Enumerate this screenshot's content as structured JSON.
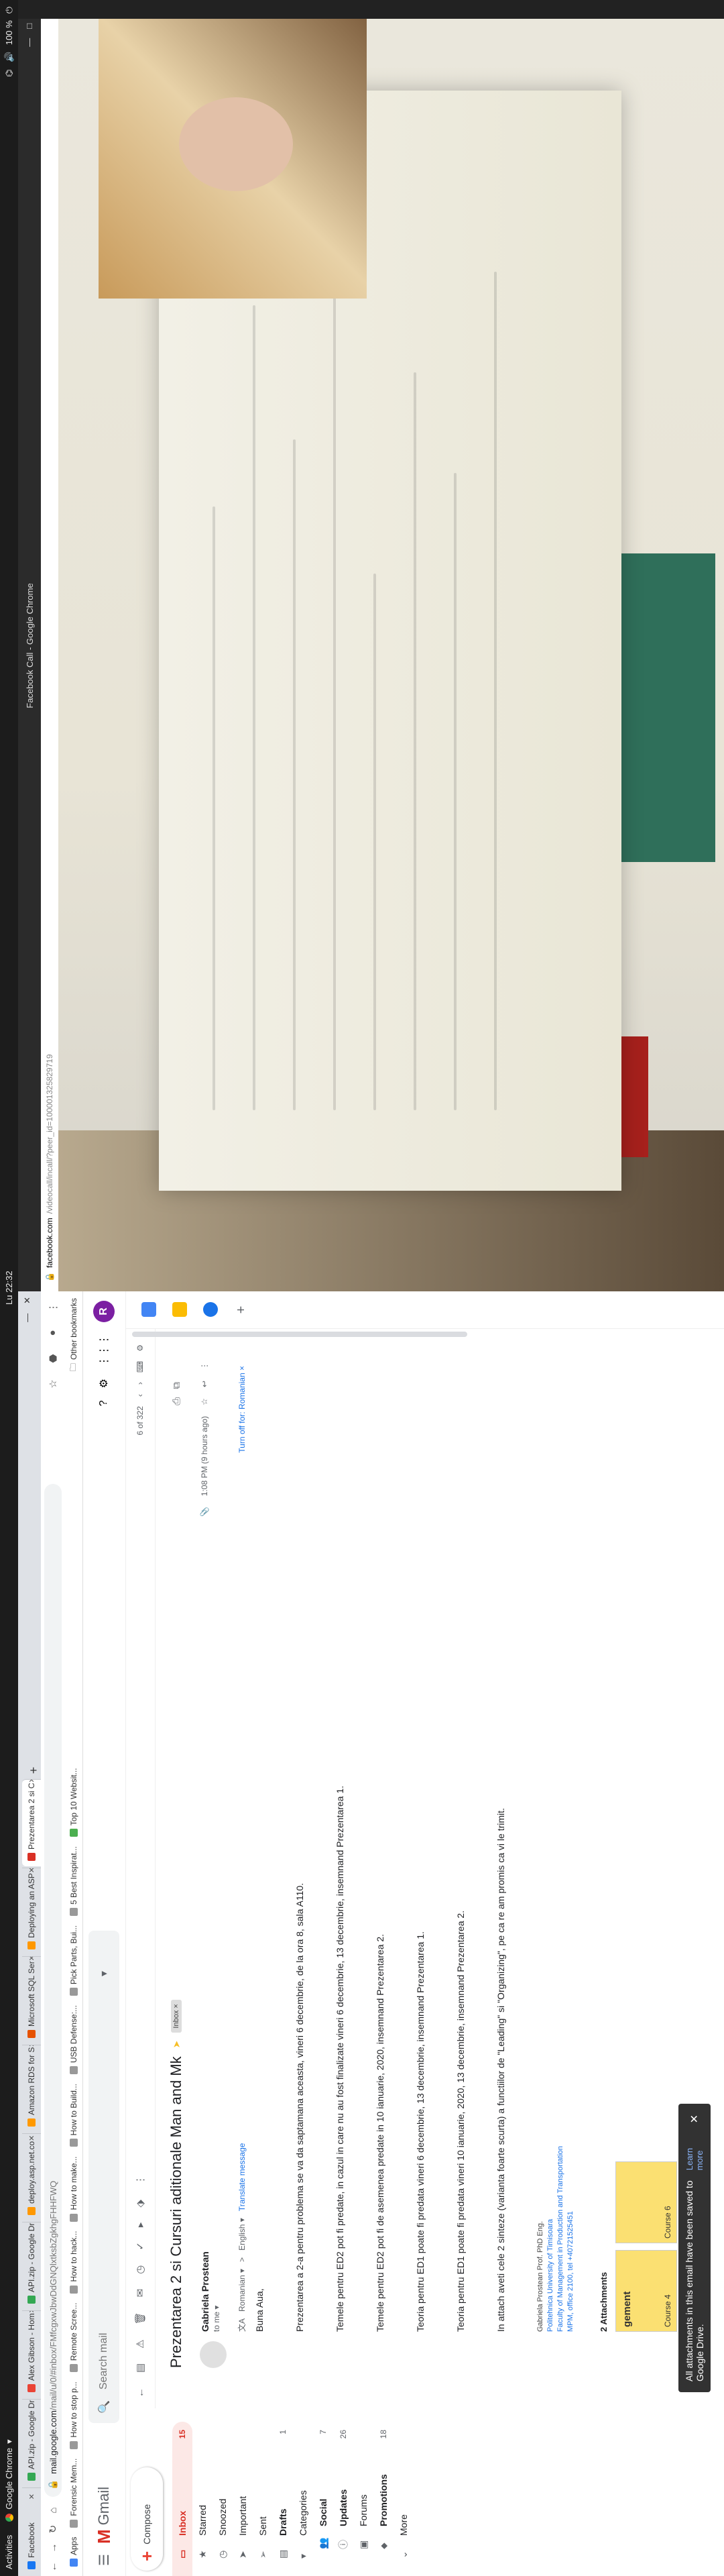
{
  "topbar": {
    "activities": "Activities",
    "app": "Google Chrome",
    "clock": "Lu 22:32",
    "battery": "100 %"
  },
  "chrome": {
    "tabs": [
      {
        "label": "Facebook",
        "color": "#1877f2"
      },
      {
        "label": "API.zip - Google Dr",
        "color": "#34a853"
      },
      {
        "label": "Alex Gibson - Hom",
        "color": "#ea4335"
      },
      {
        "label": "API.zip - Google Dr",
        "color": "#34a853"
      },
      {
        "label": "deploy.asp.net.co",
        "color": "#ff9800"
      },
      {
        "label": "Amazon RDS for S",
        "color": "#ff9900"
      },
      {
        "label": "Microsoft SQL Ser",
        "color": "#e65100"
      },
      {
        "label": "Deploying an ASP",
        "color": "#ff9800"
      },
      {
        "label": "Prezentarea 2 si C",
        "color": "#d93025"
      }
    ],
    "url_host": "mail.google.com",
    "url_rest": "/mail/u/0/#inbox/FMfcgxwJbwDdGNQlxtksbZgkhgFHHFWQ",
    "bookmarks": [
      "Apps",
      "Forensic Mem...",
      "How to stop p...",
      "Remote Scree...",
      "How to hack...",
      "How to make...",
      "How to Build...",
      "USB Defense:...",
      "Pick Parts, Bui...",
      "5 Best Inspirat...",
      "Top 10 Websit..."
    ],
    "other_bookmarks": "Other bookmarks"
  },
  "gmail": {
    "logo": "Gmail",
    "search_placeholder": "Search mail",
    "avatar_letter": "R",
    "compose": "Compose",
    "nav": [
      {
        "icon": "inbox-icon",
        "glyph": "▭",
        "label": "Inbox",
        "count": "15",
        "active": true
      },
      {
        "icon": "star-icon",
        "glyph": "★",
        "label": "Starred",
        "count": ""
      },
      {
        "icon": "clock-icon",
        "glyph": "◷",
        "label": "Snoozed",
        "count": ""
      },
      {
        "icon": "important-icon",
        "glyph": "➤",
        "label": "Important",
        "count": ""
      },
      {
        "icon": "send-icon",
        "glyph": "➢",
        "label": "Sent",
        "count": ""
      },
      {
        "icon": "draft-icon",
        "glyph": "▤",
        "label": "Drafts",
        "count": "1",
        "bold": true
      },
      {
        "icon": "categories-icon",
        "glyph": "▾",
        "label": "Categories",
        "count": ""
      },
      {
        "icon": "social-icon",
        "glyph": "👥",
        "label": "Social",
        "count": "7",
        "sub": true,
        "bold": true
      },
      {
        "icon": "updates-icon",
        "glyph": "ⓘ",
        "label": "Updates",
        "count": "26",
        "sub": true,
        "bold": true
      },
      {
        "icon": "forums-icon",
        "glyph": "▣",
        "label": "Forums",
        "count": "",
        "sub": true
      },
      {
        "icon": "promotions-icon",
        "glyph": "⬥",
        "label": "Promotions",
        "count": "18",
        "sub": true,
        "bold": true
      },
      {
        "icon": "more-icon",
        "glyph": "⌄",
        "label": "More",
        "count": ""
      }
    ],
    "pager": "6 of 322",
    "subject": "Prezentarea 2 si Cursuri aditionale Man and Mk",
    "inbox_chip": "Inbox ×",
    "sender_name": "Gabriela Prostean",
    "sender_to": "to me ▾",
    "time": "1:08 PM (9 hours ago)",
    "translate_from": "Romanian ▾",
    "translate_arrow": ">",
    "translate_to": "English ▾",
    "translate_link": "Translate message",
    "translate_off": "Turn off for: Romanian ×",
    "body": [
      "Buna Aua,",
      "Prezentarea a 2-a pentru problema se va da saptamana aceasta, vineri 6 decembrie, de la ora 8, sala A110.",
      "Temele pentru ED2 pot fi predate, in cazul in care nu au fost finalizate  vineri 6 decembrie, 13 decembrie, insemnand Prezentarea 1.",
      "Temele pentru ED2 pot fi de asemenea predate in 10 ianuarie, 2020, insemnand Prezentarea 2.",
      "Teoria pentru ED1 poate fi predata vineri 6 decembrie, 13 decembrie, insemnand Prezentarea 1.",
      "Teoria pentru ED1 poate fi predata vineri 10 ianuarie, 2020, 13 decembrie, insemnand Prezentarea 2.",
      "In attach aveti cele 2 sinteze (varianta foarte scurta) a functiilor de \"Leading\" si \"Organizing\", pe ca re am promis ca vi le trimit."
    ],
    "signature": [
      "Gabriela Prostean Prof. PhD Eng.",
      "Politehnica University of Timisoara",
      "Faculty of Management in Production and Transportation",
      "MPM, office 2100, tel +40721525451"
    ],
    "attachments_title": "2 Attachments",
    "attachments": [
      {
        "title": "gement",
        "name": "Course 4"
      },
      {
        "title": "",
        "name": "Course 6"
      }
    ],
    "toast": "All attachments in this email have been saved to Google Drive.",
    "toast_link": "Learn more"
  },
  "facebook": {
    "window_title": "Facebook Call - Google Chrome",
    "url_host": "facebook.com",
    "url_rest": "/videocall/incall/?peer_id=100001325829719"
  }
}
